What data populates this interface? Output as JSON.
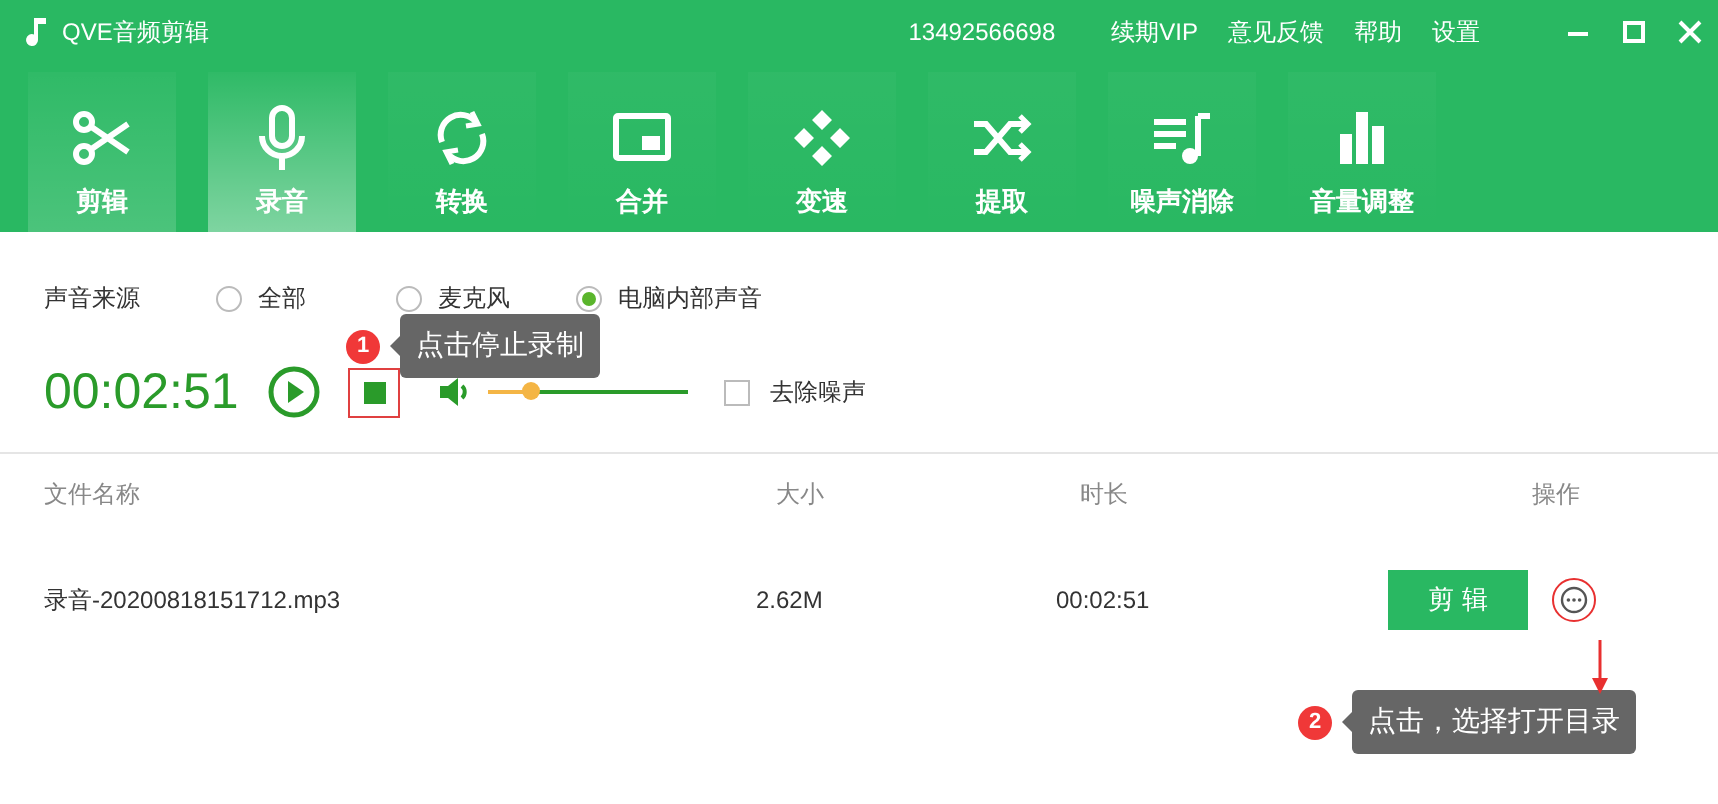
{
  "window": {
    "title": "QVE音频剪辑"
  },
  "account": {
    "phone": "13492566698"
  },
  "header_links": [
    "续期VIP",
    "意见反馈",
    "帮助",
    "设置"
  ],
  "tabs": [
    {
      "label": "剪辑",
      "selected": false,
      "highlighted": true
    },
    {
      "label": "录音",
      "selected": true,
      "highlighted": false
    },
    {
      "label": "转换",
      "selected": false,
      "highlighted": false
    },
    {
      "label": "合并",
      "selected": false,
      "highlighted": false
    },
    {
      "label": "变速",
      "selected": false,
      "highlighted": false
    },
    {
      "label": "提取",
      "selected": false,
      "highlighted": false
    },
    {
      "label": "噪声消除",
      "selected": false,
      "highlighted": false
    },
    {
      "label": "音量调整",
      "selected": false,
      "highlighted": false
    }
  ],
  "source": {
    "label": "声音来源",
    "options": [
      {
        "label": "全部",
        "selected": false
      },
      {
        "label": "麦克风",
        "selected": false
      },
      {
        "label": "电脑内部声音",
        "selected": true
      }
    ]
  },
  "recorder": {
    "time": "00:02:51",
    "volume": {
      "level": 0.21
    },
    "denoise": {
      "label": "去除噪声",
      "checked": false
    }
  },
  "table": {
    "columns": [
      "文件名称",
      "大小",
      "时长",
      "操作"
    ],
    "rows": [
      {
        "name": "录音-20200818151712.mp3",
        "size": "2.62M",
        "duration": "00:02:51",
        "action": "剪 辑"
      }
    ]
  },
  "callouts": [
    {
      "number": "1",
      "text": "点击停止录制"
    },
    {
      "number": "2",
      "text": "点击，选择打开目录"
    }
  ]
}
